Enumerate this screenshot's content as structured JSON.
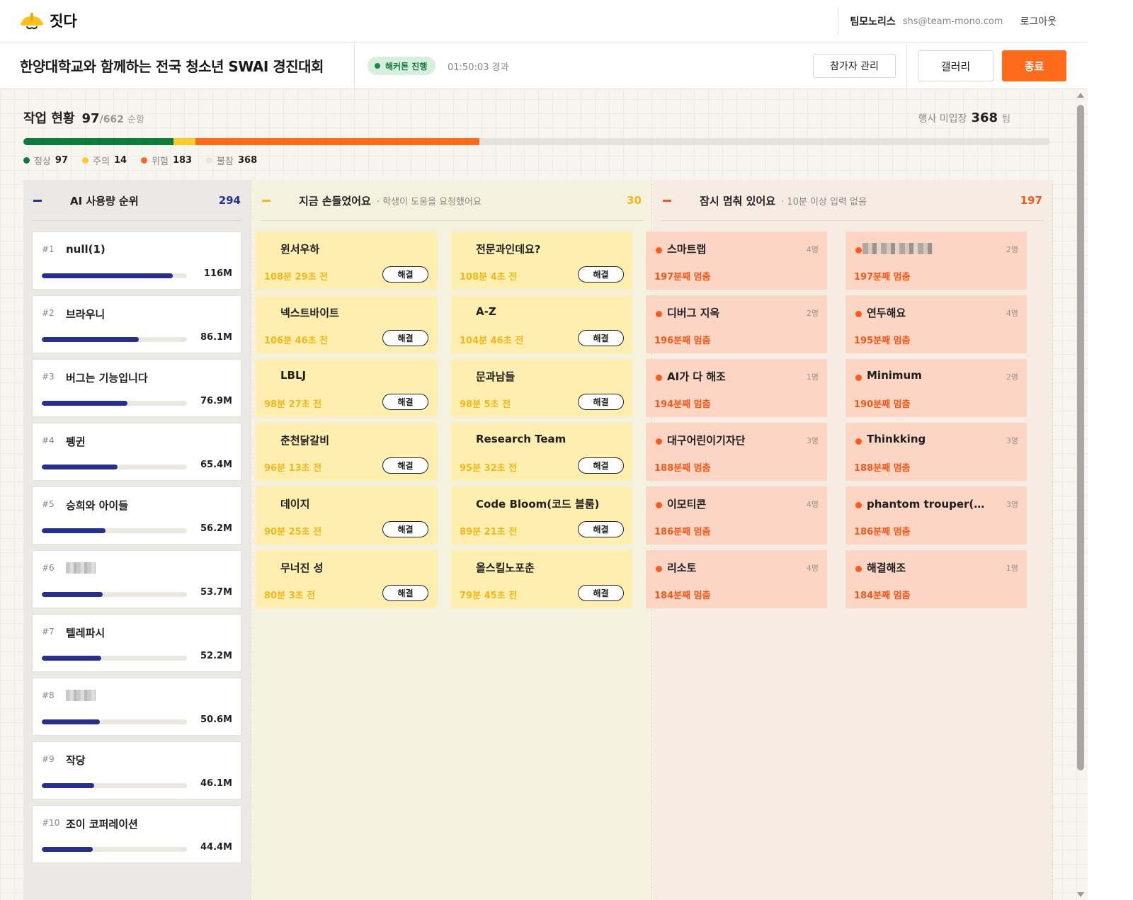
{
  "app": {
    "name": "짓다"
  },
  "user": {
    "team": "팀모노리스",
    "email": "shs@team-mono.com",
    "logout_label": "로그아웃"
  },
  "event": {
    "title": "한양대학교와 함께하는 전국 청소년 SWAI 경진대회",
    "status": "해커톤 진행",
    "elapsed": "01:50:03 경과",
    "participants_label": "참가자 관리",
    "gallery_label": "갤러리",
    "end_label": "종료"
  },
  "summary": {
    "title": "작업 현황",
    "current": "97",
    "total": "/662",
    "unit": "순항",
    "absent_label": "행사 미입장",
    "absent_value": "368",
    "absent_unit": "팀",
    "segments": [
      {
        "key": "normal",
        "label": "정상",
        "value": 97,
        "color": "#0f7a3e"
      },
      {
        "key": "warning",
        "label": "주의",
        "value": 14,
        "color": "#ffc930"
      },
      {
        "key": "danger",
        "label": "위험",
        "value": 183,
        "color": "#ff6b1a"
      },
      {
        "key": "absent",
        "label": "불참",
        "value": 368,
        "color": "#e5e2db"
      }
    ],
    "legend_values": [
      "97",
      "14",
      "183",
      "368"
    ]
  },
  "columns": {
    "ai": {
      "title": "AI 사용량 순위",
      "count": "294",
      "color": "#262f8a"
    },
    "help": {
      "title": "지금 손들었어요",
      "sub": "· 학생이 도움을 요청했어요",
      "count": "30",
      "color": "#f0b81a"
    },
    "stop": {
      "title": "잠시 멈춰 있어요",
      "sub": "· 10분 이상 입력 없음",
      "count": "197",
      "color": "#f05a1a"
    }
  },
  "ai_ranking": [
    {
      "rank": "#1",
      "name": "null(1)",
      "tokens": "116M",
      "ratio": 0.9
    },
    {
      "rank": "#2",
      "name": "브라우니",
      "tokens": "86.1M",
      "ratio": 0.67
    },
    {
      "rank": "#3",
      "name": "버그는 기능입니다",
      "tokens": "76.9M",
      "ratio": 0.59
    },
    {
      "rank": "#4",
      "name": "펭귄",
      "tokens": "65.4M",
      "ratio": 0.52
    },
    {
      "rank": "#5",
      "name": "승희와 아이들",
      "tokens": "56.2M",
      "ratio": 0.44
    },
    {
      "rank": "#6",
      "name": "",
      "tokens": "53.7M",
      "ratio": 0.42
    },
    {
      "rank": "#7",
      "name": "텔레파시",
      "tokens": "52.2M",
      "ratio": 0.41
    },
    {
      "rank": "#8",
      "name": "",
      "tokens": "50.6M",
      "ratio": 0.4
    },
    {
      "rank": "#9",
      "name": "작당",
      "tokens": "46.1M",
      "ratio": 0.36
    },
    {
      "rank": "#10",
      "name": "조이 코퍼레이션",
      "tokens": "44.4M",
      "ratio": 0.35
    }
  ],
  "help_requests": [
    {
      "name": "윈서우하",
      "time": "108분 29초 전"
    },
    {
      "name": "전문과인데요?",
      "time": "108분 4초 전"
    },
    {
      "name": "넥스트바이트",
      "time": "106분 46초 전"
    },
    {
      "name": "A-Z",
      "time": "104분 46초 전"
    },
    {
      "name": "LBLJ",
      "time": "98분 27초 전"
    },
    {
      "name": "문과남들",
      "time": "98분 5초 전"
    },
    {
      "name": "춘천닭갈비",
      "time": "96분 13초 전"
    },
    {
      "name": "Research Team",
      "time": "95분 32초 전"
    },
    {
      "name": "데이지",
      "time": "90분 25초 전"
    },
    {
      "name": "Code Bloom(코드 블룸)",
      "time": "89분 21초 전"
    },
    {
      "name": "무너진 성",
      "time": "80분 3초 전"
    },
    {
      "name": "올스킬노포춘",
      "time": "79분 45초 전"
    }
  ],
  "help_resolve_label": "해결",
  "stopped": [
    {
      "name": "스마트랩",
      "members": "4명",
      "time": "197분째 멈춤"
    },
    {
      "name": "",
      "members": "2명",
      "time": "197분째 멈춤"
    },
    {
      "name": "디버그 지옥",
      "members": "2명",
      "time": "196분째 멈춤"
    },
    {
      "name": "연두해요",
      "members": "4명",
      "time": "195분째 멈춤"
    },
    {
      "name": "AI가 다 해조",
      "members": "1명",
      "time": "194분째 멈춤"
    },
    {
      "name": "Minimum",
      "members": "2명",
      "time": "190분째 멈춤"
    },
    {
      "name": "대구어린이기자단",
      "members": "3명",
      "time": "188분째 멈춤"
    },
    {
      "name": "Thinkking",
      "members": "3명",
      "time": "188분째 멈춤"
    },
    {
      "name": "이모티콘",
      "members": "4명",
      "time": "186분째 멈춤"
    },
    {
      "name": "phantom trouper(팬텀 ...",
      "members": "3명",
      "time": "186분째 멈춤"
    },
    {
      "name": "리소토",
      "members": "4명",
      "time": "184분째 멈춤"
    },
    {
      "name": "해결해조",
      "members": "1명",
      "time": "184분째 멈춤"
    }
  ]
}
